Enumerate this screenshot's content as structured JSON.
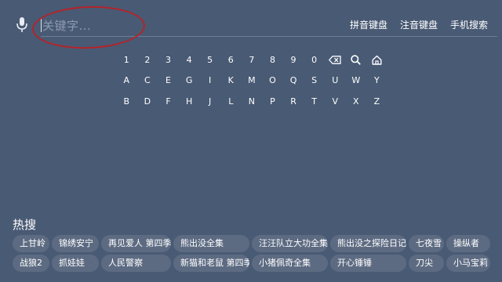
{
  "search": {
    "placeholder": "关键字..."
  },
  "mode_links": [
    "拼音键盘",
    "注音键盘",
    "手机搜索"
  ],
  "keyboard": {
    "rows": [
      [
        "1",
        "2",
        "3",
        "4",
        "5",
        "6",
        "7",
        "8",
        "9",
        "0",
        "backspace-icon",
        "search-icon",
        "home-icon"
      ],
      [
        "A",
        "C",
        "E",
        "G",
        "I",
        "K",
        "M",
        "O",
        "Q",
        "S",
        "U",
        "W",
        "Y"
      ],
      [
        "B",
        "D",
        "F",
        "H",
        "J",
        "L",
        "N",
        "P",
        "R",
        "T",
        "V",
        "X",
        "Z"
      ]
    ]
  },
  "hot": {
    "title": "热搜",
    "rows": [
      [
        "上甘岭",
        "锦绣安宁",
        "再见爱人 第四季",
        "熊出没全集",
        "汪汪队立大功全集",
        "熊出没之探险日记",
        "七夜雪",
        "操纵者"
      ],
      [
        "战狼2",
        "抓娃娃",
        "人民警察",
        "新猫和老鼠 第四季",
        "小猪佩奇全集",
        "开心锤锤",
        "刀尖",
        "小马宝莉"
      ]
    ]
  },
  "colors": {
    "background": "#495a74",
    "chip": "#5d6b82",
    "annotation": "#b3242a"
  }
}
